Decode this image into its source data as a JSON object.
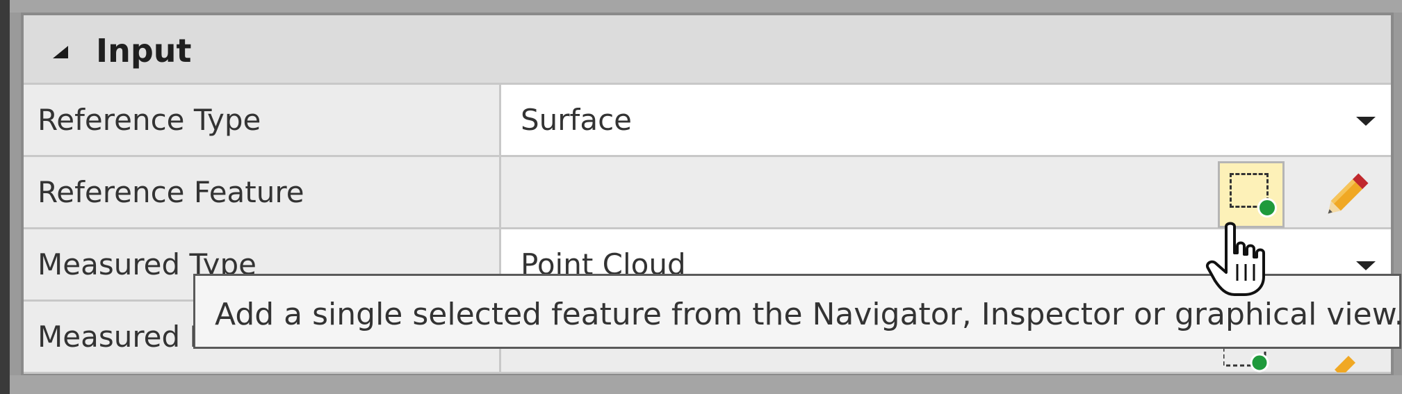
{
  "group": {
    "title": "Input",
    "expanded": true
  },
  "rows": [
    {
      "label": "Reference Type",
      "value": "Surface",
      "kind": "dropdown"
    },
    {
      "label": "Reference Feature",
      "value": "",
      "kind": "feature-picker"
    },
    {
      "label": "Measured Type",
      "value": "Point Cloud",
      "kind": "dropdown"
    },
    {
      "label": "Measured Feature",
      "value": "",
      "kind": "feature-picker"
    }
  ],
  "tooltip": {
    "text": "Add a single selected feature from the Navigator, Inspector or graphical view."
  },
  "icons": {
    "select_button": "add-selected-feature-icon",
    "edit_button": "pencil-icon",
    "cursor": "hand-cursor-icon"
  },
  "colors": {
    "select_button_bg": "#fdf1b8",
    "green_badge": "#1f9a3c",
    "pencil_body": "#f0a824",
    "pencil_tip": "#c0282d"
  }
}
